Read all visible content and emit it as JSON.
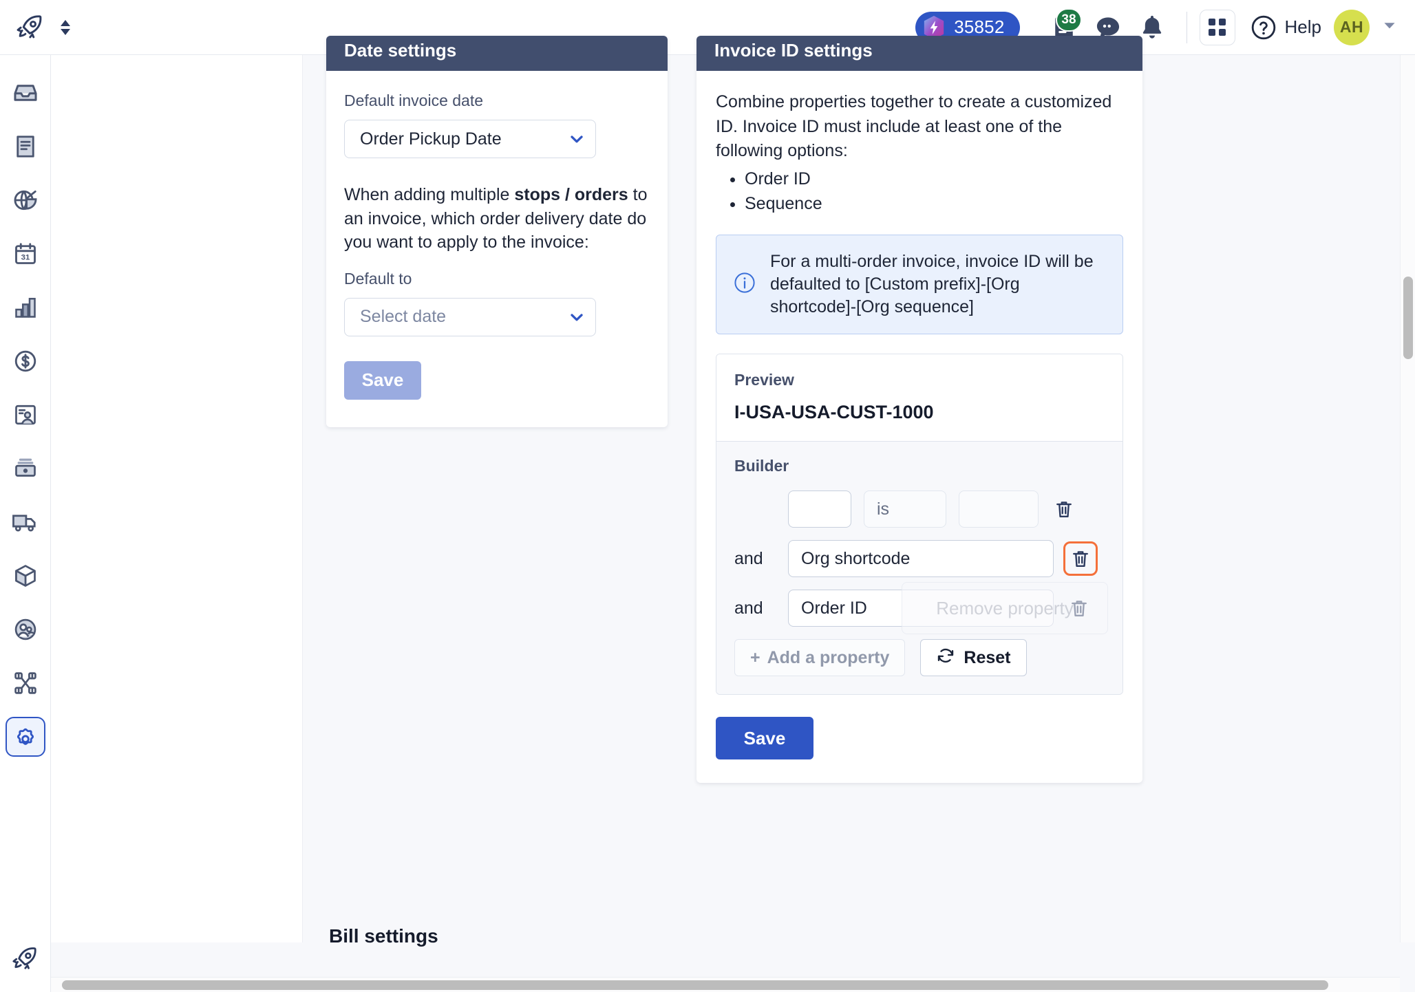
{
  "topbar": {
    "brand_icon": "rocket-icon",
    "sort_icon": "up-down-arrows-icon",
    "points": "35852",
    "points_icon": "gem-icon",
    "documents_icon": "document-icon",
    "documents_badge": "38",
    "chat_icon": "chat-bubble-icon",
    "bell_icon": "bell-icon",
    "grid_icon": "app-grid-icon",
    "help_icon": "question-circle-icon",
    "help_label": "Help",
    "avatar_initials": "AH",
    "avatar_caret_icon": "chevron-down-icon"
  },
  "sidebar": {
    "items": [
      {
        "name": "inbox",
        "icon": "inbox-icon",
        "active": false
      },
      {
        "name": "documents",
        "icon": "document-lines-icon",
        "active": false
      },
      {
        "name": "dispatch",
        "icon": "globe-pie-icon",
        "active": false
      },
      {
        "name": "calendar",
        "icon": "calendar-31-icon",
        "active": false
      },
      {
        "name": "reports",
        "icon": "bar-chart-icon",
        "active": false
      },
      {
        "name": "billing",
        "icon": "dollar-circle-icon",
        "active": false
      },
      {
        "name": "contacts",
        "icon": "id-card-icon",
        "active": false
      },
      {
        "name": "inventory",
        "icon": "archive-box-icon",
        "active": false
      },
      {
        "name": "fleet",
        "icon": "truck-icon",
        "active": false
      },
      {
        "name": "packages",
        "icon": "cube-icon",
        "active": false
      },
      {
        "name": "customers",
        "icon": "users-circle-icon",
        "active": false
      },
      {
        "name": "integrations",
        "icon": "network-nodes-icon",
        "active": false
      },
      {
        "name": "settings",
        "icon": "gear-icon",
        "active": true
      }
    ],
    "bottom_icon": "rocket-icon"
  },
  "date_settings": {
    "title": "Date settings",
    "default_invoice_date_label": "Default invoice date",
    "default_invoice_date_value": "Order Pickup Date",
    "paragraph_part1": "When adding multiple ",
    "paragraph_bold": "stops / orders",
    "paragraph_part2": " to an invoice, which order delivery date do you want to apply to the invoice:",
    "default_to_label": "Default to",
    "default_to_placeholder": "Select date",
    "save_label": "Save",
    "chevron_icon": "chevron-down-icon"
  },
  "invoice_id_settings": {
    "title": "Invoice ID settings",
    "description": "Combine properties together to create a customized ID. Invoice ID must include at least one of the following options:",
    "required_options": [
      "Order ID",
      "Sequence"
    ],
    "info_icon": "info-circle-icon",
    "info_text": "For a multi-order invoice, invoice ID will be defaulted to [Custom prefix]-[Org shortcode]-[Org sequence]",
    "preview_label": "Preview",
    "preview_value": "I-USA-USA-CUST-1000",
    "builder_label": "Builder",
    "builder_rows": [
      {
        "conjunction": "",
        "field": "",
        "operator": "is",
        "value": "",
        "trash_icon": "trash-icon",
        "highlighted": false
      },
      {
        "conjunction": "and",
        "field": "Org shortcode",
        "operator": "",
        "value": "",
        "trash_icon": "trash-icon",
        "highlighted": true
      },
      {
        "conjunction": "and",
        "field": "Order ID",
        "operator": "",
        "value": "",
        "trash_icon": "trash-icon",
        "highlighted": false
      }
    ],
    "add_property_label": "Add a property",
    "add_property_icon": "plus-icon",
    "add_property_disabled": true,
    "reset_label": "Reset",
    "reset_icon": "refresh-icon",
    "save_label": "Save"
  },
  "tooltip": {
    "remove_property": "Remove property"
  },
  "bill_settings": {
    "title": "Bill settings"
  },
  "colors": {
    "brand_blue": "#2f55c4",
    "card_header": "#414e6e",
    "highlight_orange": "#f4703a",
    "badge_green": "#1e7a45",
    "avatar_yellow": "#d6df4e",
    "info_bg": "#eaf1fd",
    "page_bg": "#f7f8fb"
  },
  "scrollbars": {
    "vertical": "scrollbar-vertical",
    "horizontal": "scrollbar-horizontal"
  }
}
